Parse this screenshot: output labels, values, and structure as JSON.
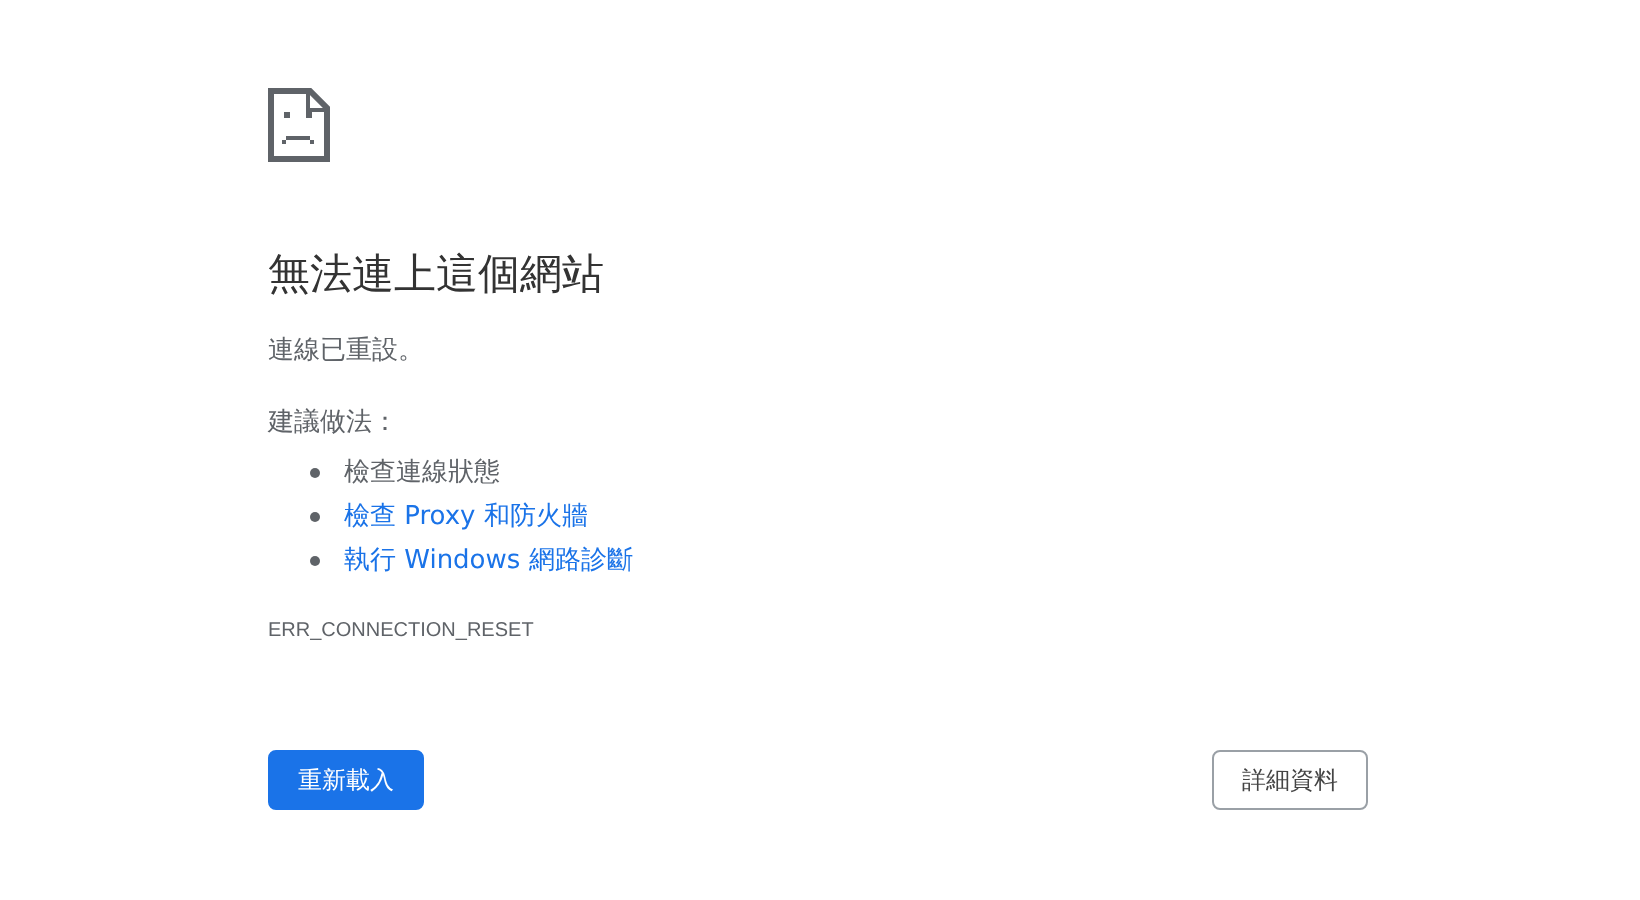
{
  "heading": "無法連上這個網站",
  "message": "連線已重設。",
  "suggestions_title": "建議做法：",
  "suggestions": [
    {
      "kind": "text",
      "label": "檢查連線狀態"
    },
    {
      "kind": "link",
      "label": "檢查 Proxy 和防火牆"
    },
    {
      "kind": "link",
      "label": "執行 Windows 網路診斷"
    }
  ],
  "error_code": "ERR_CONNECTION_RESET",
  "buttons": [
    {
      "kind": "primary",
      "label": "重新載入"
    },
    {
      "kind": "secondary",
      "label": "詳細資料"
    }
  ]
}
